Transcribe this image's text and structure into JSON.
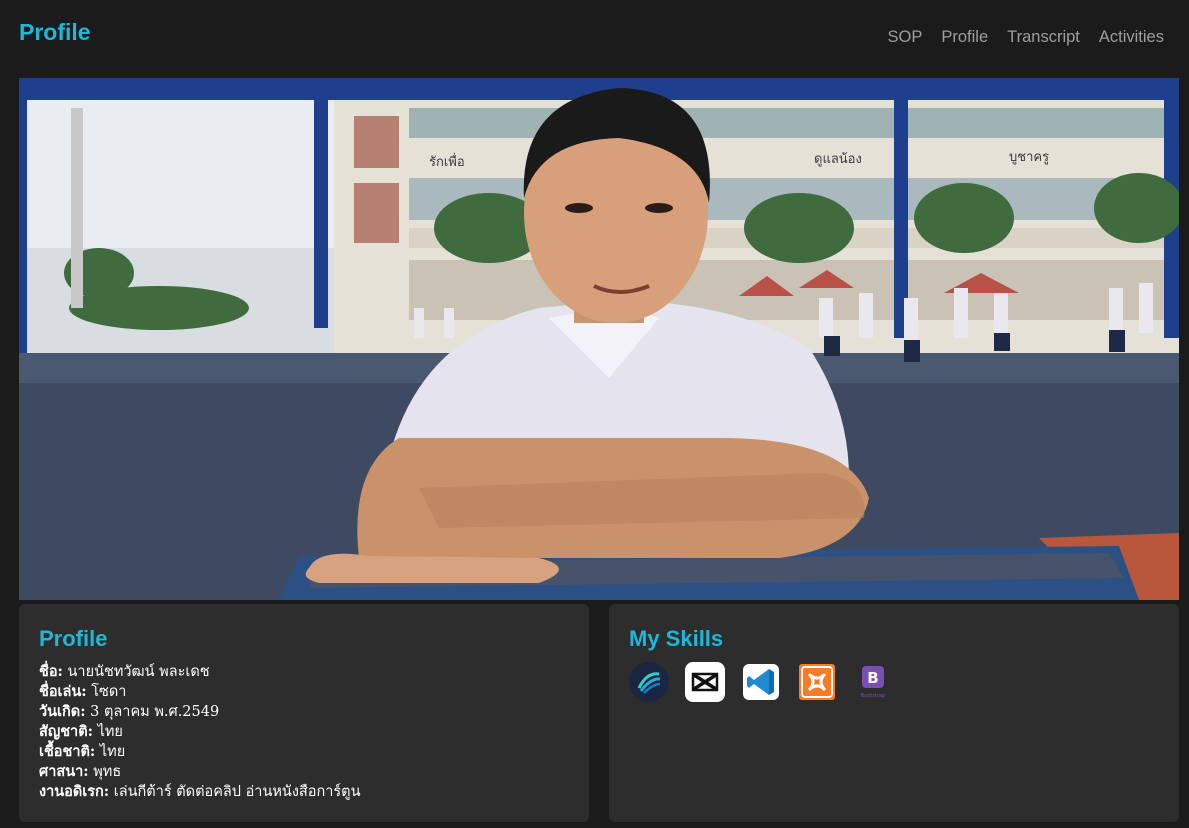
{
  "header": {
    "brand": "Profile",
    "nav": [
      "SOP",
      "Profile",
      "Transcript",
      "Activities"
    ]
  },
  "hero": {
    "building_signs": [
      "รักเพื่อ",
      "ดูแลน้อง",
      "บูชาครู"
    ]
  },
  "profile_card": {
    "title": "Profile",
    "rows": [
      {
        "label": "ชื่อ:",
        "value": "นายนัชทวัฒน์ พละเดช"
      },
      {
        "label": "ชื่อเล่น:",
        "value": "โซดา"
      },
      {
        "label": "วันเกิด:",
        "value": "3 ตุลาคม พ.ศ.2549"
      },
      {
        "label": "สัญชาติ:",
        "value": "ไทย"
      },
      {
        "label": "เชื้อชาติ:",
        "value": "ไทย"
      },
      {
        "label": "ศาสนา:",
        "value": "พุทธ"
      },
      {
        "label": "งานอดิเรก:",
        "value": "เล่นกีต้าร์ ตัดต่อคลิป อ่านหนังสือการ์ตูน"
      }
    ]
  },
  "skills_card": {
    "title": "My Skills",
    "icons": [
      "alight-motion-icon",
      "capcut-icon",
      "vscode-icon",
      "xampp-icon",
      "bootstrap-icon"
    ],
    "bootstrap_caption": "Bootstrap"
  },
  "colors": {
    "accent": "#1fb6d8",
    "background": "#1b1b1b",
    "card": "#2d2d2d",
    "nav": "#9e9e9e"
  }
}
